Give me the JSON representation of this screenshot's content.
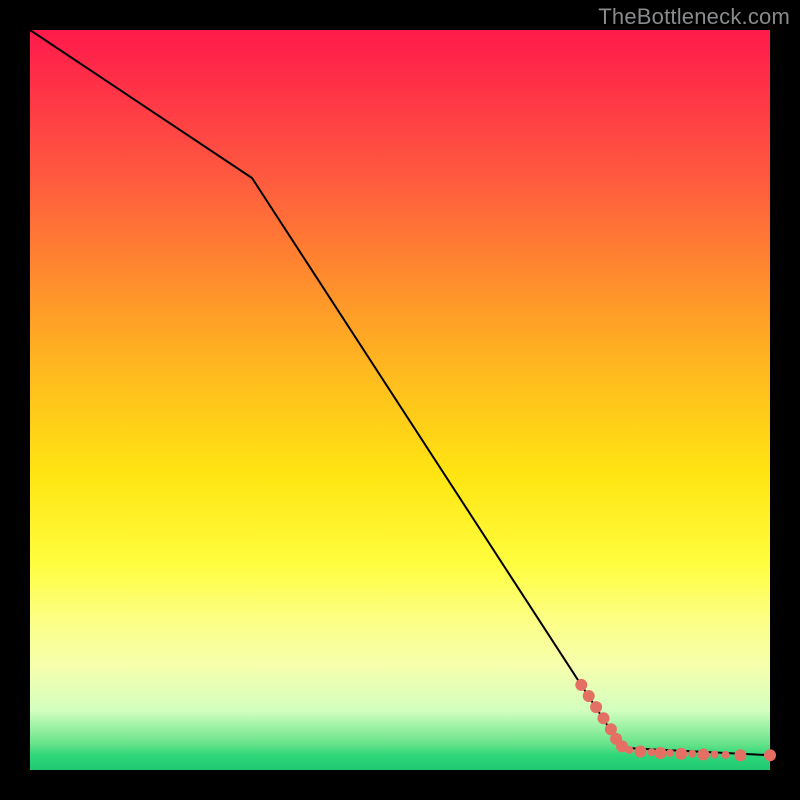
{
  "attribution": "TheBottleneck.com",
  "chart_data": {
    "type": "line",
    "title": "",
    "xlabel": "",
    "ylabel": "",
    "xlim": [
      0,
      100
    ],
    "ylim": [
      0,
      100
    ],
    "series": [
      {
        "name": "curve",
        "x": [
          0,
          30,
          80,
          100
        ],
        "y": [
          100,
          80,
          3,
          2
        ],
        "color": "#000000"
      }
    ],
    "markers": {
      "name": "highlighted-points",
      "color": "#e37063",
      "radius_small": 4,
      "radius_large": 6,
      "points": [
        {
          "x": 74.5,
          "y": 11.5,
          "r": "large"
        },
        {
          "x": 75.5,
          "y": 10.0,
          "r": "large"
        },
        {
          "x": 76.5,
          "y": 8.5,
          "r": "large"
        },
        {
          "x": 77.5,
          "y": 7.0,
          "r": "large"
        },
        {
          "x": 78.5,
          "y": 5.5,
          "r": "large"
        },
        {
          "x": 79.2,
          "y": 4.2,
          "r": "large"
        },
        {
          "x": 80.0,
          "y": 3.2,
          "r": "large"
        },
        {
          "x": 81.0,
          "y": 2.7,
          "r": "small"
        },
        {
          "x": 82.5,
          "y": 2.5,
          "r": "large"
        },
        {
          "x": 84.0,
          "y": 2.4,
          "r": "small"
        },
        {
          "x": 85.2,
          "y": 2.3,
          "r": "large"
        },
        {
          "x": 86.5,
          "y": 2.3,
          "r": "small"
        },
        {
          "x": 88.0,
          "y": 2.2,
          "r": "large"
        },
        {
          "x": 89.5,
          "y": 2.2,
          "r": "small"
        },
        {
          "x": 91.0,
          "y": 2.1,
          "r": "large"
        },
        {
          "x": 92.5,
          "y": 2.1,
          "r": "small"
        },
        {
          "x": 94.0,
          "y": 2.05,
          "r": "small"
        },
        {
          "x": 96.0,
          "y": 2.0,
          "r": "large"
        },
        {
          "x": 100.0,
          "y": 2.0,
          "r": "large"
        }
      ]
    }
  }
}
